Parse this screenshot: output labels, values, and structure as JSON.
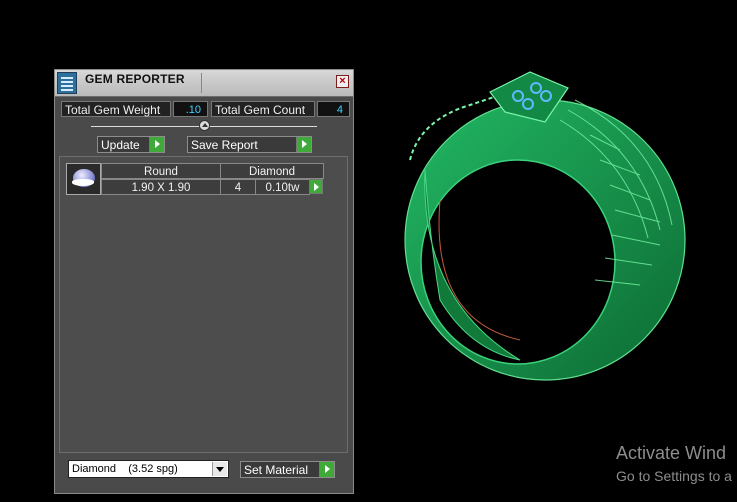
{
  "window": {
    "title": "GEM REPORTER",
    "close_symbol": "×"
  },
  "stats": {
    "total_weight_label": "Total Gem Weight",
    "total_weight_value": ".10",
    "total_count_label": "Total Gem Count",
    "total_count_value": "4"
  },
  "actions": {
    "update_label": "Update",
    "save_report_label": "Save Report"
  },
  "gem_table": {
    "columns": [
      "Round",
      "Diamond"
    ],
    "rows": [
      {
        "size": "1.90 X 1.90",
        "count": "4",
        "weight": "0.10tw"
      }
    ]
  },
  "material": {
    "selected": "Diamond    (3.52 spg)",
    "set_label": "Set Material"
  },
  "watermark": {
    "line1": "Activate Wind",
    "line2": "Go to Settings to a"
  },
  "colors": {
    "panel_bg": "#4a4a4a",
    "accent_green": "#3faa39",
    "value_cyan": "#3fd3ff",
    "ring_green": "#1fa35a"
  }
}
